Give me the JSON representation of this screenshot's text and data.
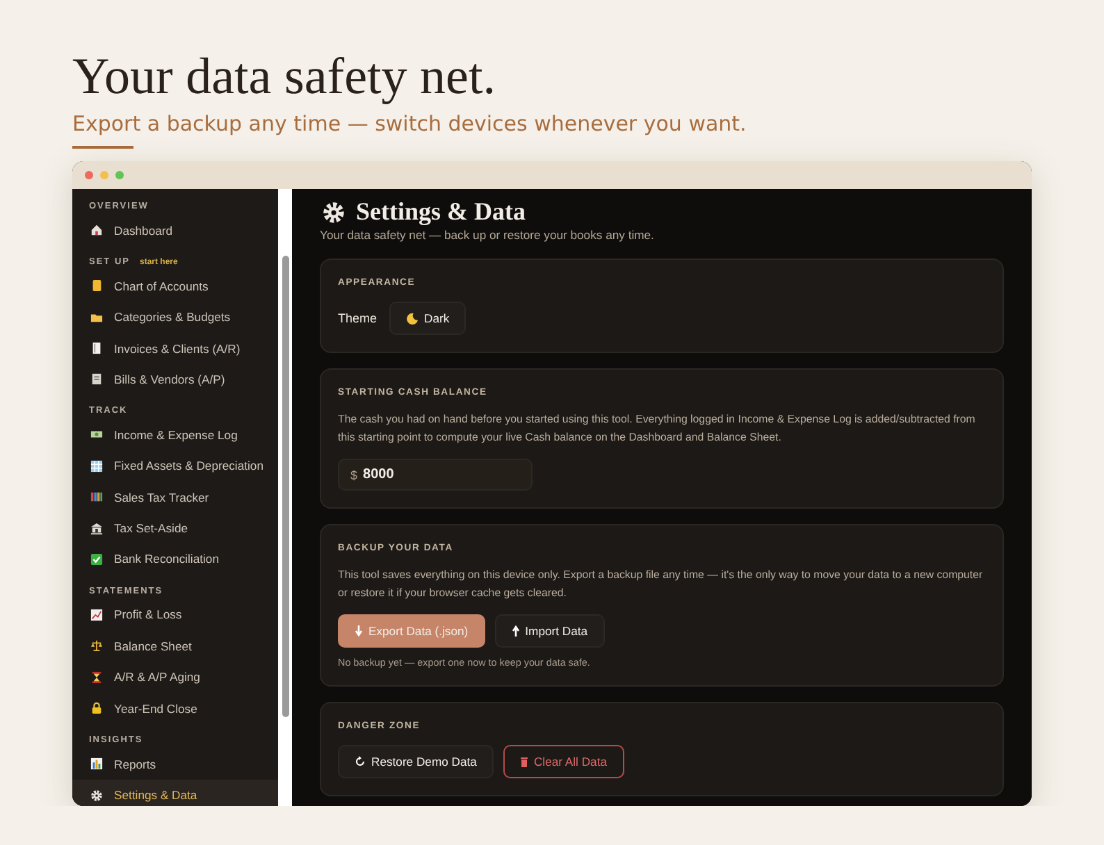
{
  "hero": {
    "title": "Your data safety net.",
    "subtitle": "Export a backup any time — switch devices whenever you want."
  },
  "sidebar": {
    "sections": [
      {
        "heading": "OVERVIEW",
        "items": [
          {
            "label": "Dashboard",
            "selected": false
          }
        ]
      },
      {
        "heading": "SET UP",
        "tag": "start here",
        "items": [
          {
            "label": "Chart of Accounts",
            "selected": false
          },
          {
            "label": "Categories & Budgets",
            "selected": false
          },
          {
            "label": "Invoices & Clients (A/R)",
            "selected": false
          },
          {
            "label": "Bills & Vendors (A/P)",
            "selected": false
          }
        ]
      },
      {
        "heading": "TRACK",
        "items": [
          {
            "label": "Income & Expense Log",
            "selected": false
          },
          {
            "label": "Fixed Assets & Depreciation",
            "selected": false
          },
          {
            "label": "Sales Tax Tracker",
            "selected": false
          },
          {
            "label": "Tax Set-Aside",
            "selected": false
          },
          {
            "label": "Bank Reconciliation",
            "selected": false
          }
        ]
      },
      {
        "heading": "STATEMENTS",
        "items": [
          {
            "label": "Profit & Loss",
            "selected": false
          },
          {
            "label": "Balance Sheet",
            "selected": false
          },
          {
            "label": "A/R & A/P Aging",
            "selected": false
          },
          {
            "label": "Year-End Close",
            "selected": false
          }
        ]
      },
      {
        "heading": "INSIGHTS",
        "items": [
          {
            "label": "Reports",
            "selected": false
          },
          {
            "label": "Settings & Data",
            "selected": true
          }
        ]
      }
    ]
  },
  "main": {
    "title": "Settings & Data",
    "subtitle": "Your data safety net — back up or restore your books any time.",
    "cards": [
      {
        "kind": "theme",
        "heading": "APPEARANCE",
        "label": "Theme",
        "button": "Dark"
      },
      {
        "kind": "cash",
        "heading": "STARTING CASH BALANCE",
        "description": "The cash you had on hand before you started using this tool. Everything logged in Income & Expense Log is added/subtracted from this starting point to compute your live Cash balance on the Dashboard and Balance Sheet.",
        "currency": "$",
        "value": "8000"
      },
      {
        "kind": "backup",
        "heading": "BACKUP YOUR DATA",
        "description": "This tool saves everything on this device only. Export a backup file any time — it's the only way to move your data to a new computer or restore it if your browser cache gets cleared.",
        "buttons": [
          {
            "label": "Export Data (.json)",
            "kind": "primary"
          },
          {
            "label": "Import Data",
            "kind": "secondary"
          }
        ],
        "note": "No backup yet — export one now to keep your data safe."
      },
      {
        "kind": "danger",
        "heading": "DANGER ZONE",
        "buttons": [
          {
            "label": "Restore Demo Data",
            "kind": "secondary"
          },
          {
            "label": "Clear All Data",
            "kind": "danger"
          }
        ]
      }
    ]
  }
}
